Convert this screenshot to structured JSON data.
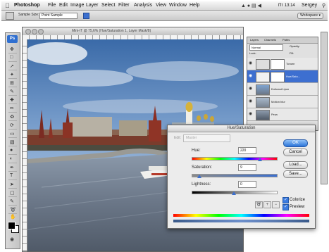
{
  "menubar": {
    "apple": "",
    "app": "Photoshop",
    "items": [
      "File",
      "Edit",
      "Image",
      "Layer",
      "Select",
      "Filter",
      "Analysis",
      "View",
      "Window",
      "Help"
    ],
    "clock": "Пт 13:14",
    "user": "Sergey"
  },
  "options": {
    "sample_size_label": "Sample Size:",
    "sample_size_value": "Point Sample",
    "workspace": "Workspace ▾"
  },
  "document": {
    "title": "Mini-IT @ 75,6% (Hue/Saturation 1, Layer Mask/8)"
  },
  "layers": {
    "tabs": [
      "Layers",
      "Channels",
      "Paths"
    ],
    "mode": "Normal",
    "opacity_label": "Opacity:",
    "fill_label": "Fill:",
    "lock_label": "Lock:",
    "rows": [
      {
        "name": "Тонинг"
      },
      {
        "name": "Hue/Satu..."
      },
      {
        "name": "Блёклый фон"
      },
      {
        "name": "Motion blur"
      },
      {
        "name": "Река"
      }
    ]
  },
  "dialog": {
    "title": "Hue/Saturation",
    "edit_label": "Edit:",
    "edit_value": "Master",
    "hue_label": "Hue:",
    "hue_value": "220",
    "saturation_label": "Saturation:",
    "saturation_value": "9",
    "lightness_label": "Lightness:",
    "lightness_value": "0",
    "ok": "OK",
    "cancel": "Cancel",
    "load": "Load...",
    "save": "Save...",
    "colorize_label": "Colorize",
    "preview_label": "Preview",
    "hue_level": 0.805,
    "saturation_level": 0.09,
    "lightness_level": 0.5
  },
  "colors": {
    "accent": "#2a74d8",
    "selected_layer": "#3d6fd0"
  }
}
